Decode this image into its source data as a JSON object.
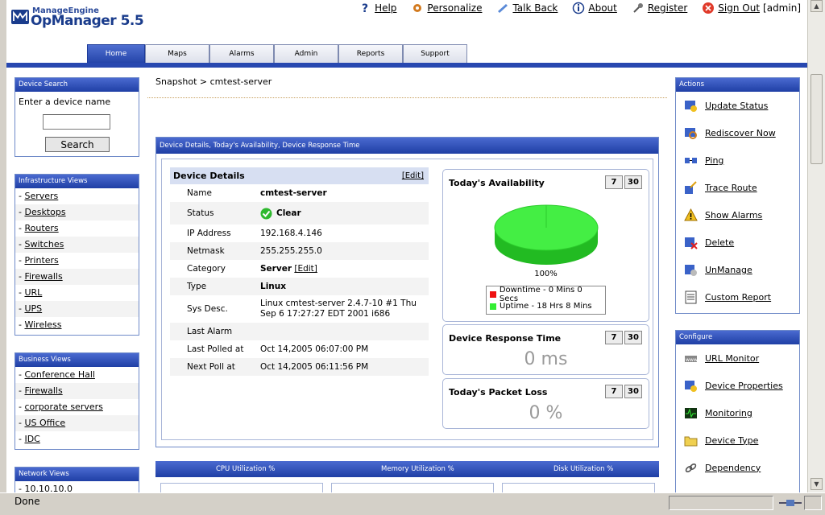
{
  "logo": {
    "brand": "ManageEngine",
    "product": "OpManager 5.5"
  },
  "toplinks": [
    {
      "label": "Help",
      "icon": "help-icon"
    },
    {
      "label": "Personalize",
      "icon": "personalize-icon"
    },
    {
      "label": "Talk Back",
      "icon": "talkback-icon"
    },
    {
      "label": "About",
      "icon": "about-icon"
    },
    {
      "label": "Register",
      "icon": "register-icon"
    },
    {
      "label": "Sign Out",
      "icon": "signout-icon"
    }
  ],
  "user": "[admin]",
  "tabs": [
    "Home",
    "Maps",
    "Alarms",
    "Admin",
    "Reports",
    "Support"
  ],
  "search": {
    "title": "Device Search",
    "label": "Enter a device name",
    "value": "",
    "button": "Search"
  },
  "infra": {
    "title": "Infrastructure Views",
    "items": [
      "Servers",
      "Desktops",
      "Routers",
      "Switches",
      "Printers",
      "Firewalls",
      "URL",
      "UPS",
      "Wireless"
    ]
  },
  "business": {
    "title": "Business Views",
    "items": [
      "Conference Hall",
      "Firewalls",
      "corporate servers",
      "US Office",
      "IDC"
    ]
  },
  "network": {
    "title": "Network Views",
    "items": [
      "10.10.10.0"
    ]
  },
  "breadcrumb": "Snapshot > cmtest-server",
  "main": {
    "title": "Device Details, Today's Availability, Device Response Time",
    "details_title": "Device Details",
    "edit": "[Edit]",
    "rows": {
      "name_k": "Name",
      "name_v": "cmtest-server",
      "status_k": "Status",
      "status_v": "Clear",
      "ip_k": "IP Address",
      "ip_v": "192.168.4.146",
      "mask_k": "Netmask",
      "mask_v": "255.255.255.0",
      "cat_k": "Category",
      "cat_v": "Server",
      "cat_edit": "[Edit]",
      "type_k": "Type",
      "type_v": "Linux",
      "sys_k": "Sys Desc.",
      "sys_v": "Linux cmtest-server 2.4.7-10 #1 Thu Sep 6 17:27:27 EDT 2001 i686",
      "alarm_k": "Last Alarm",
      "alarm_v": "",
      "polled_k": "Last Polled at",
      "polled_v": "Oct 14,2005 06:07:00 PM",
      "next_k": "Next Poll at",
      "next_v": "Oct 14,2005 06:11:56 PM"
    },
    "availability": {
      "title": "Today's Availability",
      "b7": "7",
      "b30": "30",
      "percent_label": "100%",
      "downtime": "Downtime - 0 Mins 0 Secs",
      "uptime": "Uptime - 18 Hrs 8 Mins",
      "colors": {
        "down": "#ee1111",
        "up": "#33ee33"
      }
    },
    "response": {
      "title": "Device Response Time",
      "b7": "7",
      "b30": "30",
      "value": "0 ms"
    },
    "packet": {
      "title": "Today's Packet Loss",
      "b7": "7",
      "b30": "30",
      "value": "0 %"
    }
  },
  "utilization": [
    "CPU Utilization %",
    "Memory Utilization %",
    "Disk Utilization %"
  ],
  "actions": {
    "title": "Actions",
    "items": [
      {
        "label": "Update Status",
        "icon": "update-status-icon"
      },
      {
        "label": "Rediscover Now",
        "icon": "rediscover-icon"
      },
      {
        "label": "Ping",
        "icon": "ping-icon"
      },
      {
        "label": "Trace Route",
        "icon": "trace-route-icon"
      },
      {
        "label": "Show Alarms",
        "icon": "alarm-icon"
      },
      {
        "label": "Delete",
        "icon": "delete-icon"
      },
      {
        "label": "UnManage",
        "icon": "unmanage-icon"
      },
      {
        "label": "Custom Report",
        "icon": "report-icon"
      }
    ]
  },
  "configure": {
    "title": "Configure",
    "items": [
      {
        "label": "URL Monitor",
        "icon": "url-monitor-icon"
      },
      {
        "label": "Device Properties",
        "icon": "device-properties-icon"
      },
      {
        "label": "Monitoring",
        "icon": "monitoring-icon"
      },
      {
        "label": "Device Type",
        "icon": "folder-icon"
      },
      {
        "label": "Dependency",
        "icon": "dependency-icon"
      }
    ]
  },
  "status_bar": "Done",
  "theme": {
    "accent": "#2848b0",
    "panel_head": "#1f3fa5"
  }
}
